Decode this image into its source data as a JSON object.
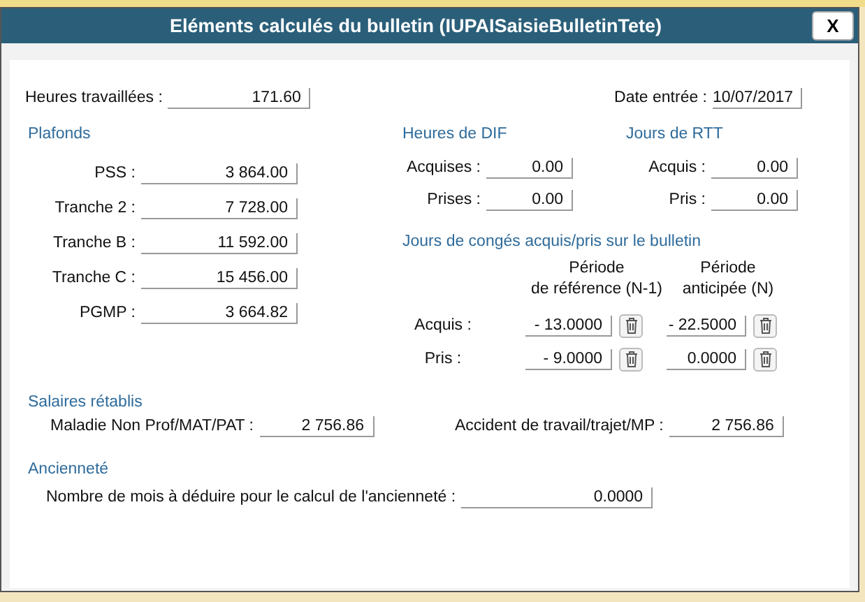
{
  "window": {
    "title": "Eléments calculés du bulletin (IUPAISaisieBulletinTete)",
    "close_label": "X"
  },
  "heures_travaillees": {
    "label": "Heures travaillées :",
    "value": "171.60"
  },
  "date_entree": {
    "label": "Date entrée :",
    "value": "10/07/2017"
  },
  "plafonds": {
    "title": "Plafonds",
    "fields": [
      {
        "label": "PSS :",
        "value": "3 864.00"
      },
      {
        "label": "Tranche 2 :",
        "value": "7 728.00"
      },
      {
        "label": "Tranche B :",
        "value": "11 592.00"
      },
      {
        "label": "Tranche C :",
        "value": "15 456.00"
      },
      {
        "label": "PGMP :",
        "value": "3 664.82"
      }
    ]
  },
  "heures_dif": {
    "title": "Heures de DIF",
    "fields": [
      {
        "label": "Acquises :",
        "value": "0.00"
      },
      {
        "label": "Prises :",
        "value": "0.00"
      }
    ]
  },
  "jours_rtt": {
    "title": "Jours de RTT",
    "fields": [
      {
        "label": "Acquis :",
        "value": "0.00"
      },
      {
        "label": "Pris :",
        "value": "0.00"
      }
    ]
  },
  "conges": {
    "title": "Jours de congés acquis/pris sur le bulletin",
    "columns": [
      "Période\nde référence (N-1)",
      "Période\nanticipée (N)"
    ],
    "rows": [
      {
        "label": "Acquis :",
        "values": [
          "- 13.0000",
          "- 22.5000"
        ]
      },
      {
        "label": "Pris :",
        "values": [
          "- 9.0000",
          "0.0000"
        ]
      }
    ]
  },
  "salaires_retablis": {
    "title": "Salaires rétablis",
    "fields": [
      {
        "label": "Maladie Non Prof/MAT/PAT :",
        "value": "2 756.86"
      },
      {
        "label": "Accident de travail/trajet/MP :",
        "value": "2 756.86"
      }
    ]
  },
  "anciennete": {
    "title": "Ancienneté",
    "fields": [
      {
        "label": "Nombre de mois à déduire pour le calcul de l'ancienneté :",
        "value": "0.0000"
      }
    ]
  }
}
